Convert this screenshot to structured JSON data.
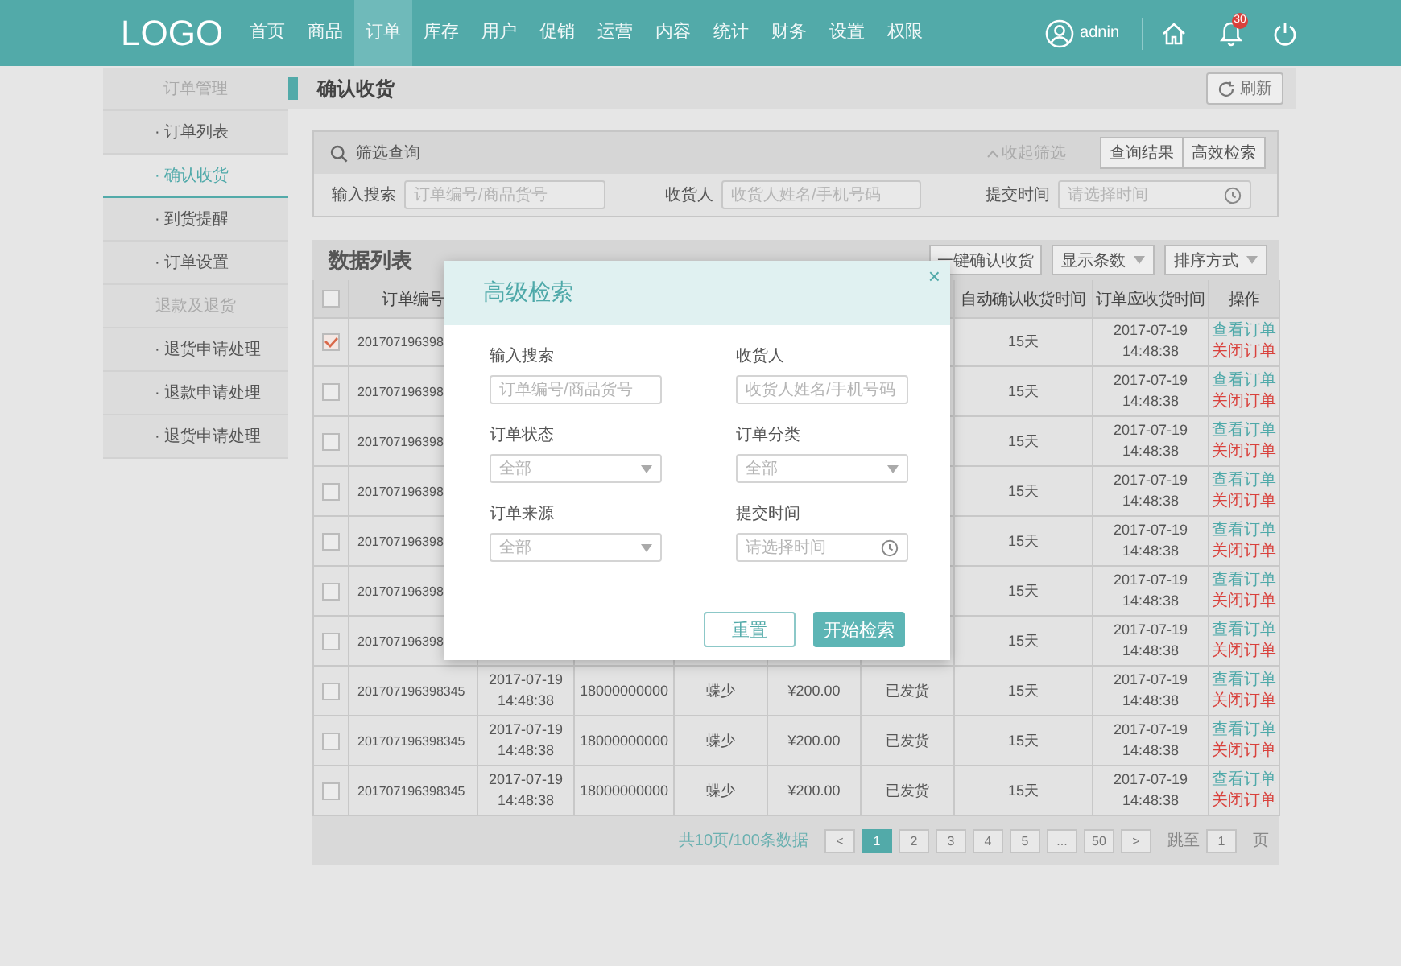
{
  "nav": {
    "logo": "LOGO",
    "items": [
      {
        "label": "首页",
        "selected": false
      },
      {
        "label": "商品",
        "selected": false
      },
      {
        "label": "订单",
        "selected": true
      },
      {
        "label": "库存",
        "selected": false
      },
      {
        "label": "用户",
        "selected": false
      },
      {
        "label": "促销",
        "selected": false
      },
      {
        "label": "运营",
        "selected": false
      },
      {
        "label": "内容",
        "selected": false
      },
      {
        "label": "统计",
        "selected": false
      },
      {
        "label": "财务",
        "selected": false
      },
      {
        "label": "设置",
        "selected": false
      },
      {
        "label": "权限",
        "selected": false
      }
    ],
    "user": "adnin",
    "notification_count": "30"
  },
  "sidebar": {
    "items": [
      {
        "kind": "heading",
        "label": "订单管理"
      },
      {
        "kind": "link",
        "label": "· 订单列表",
        "selected": false
      },
      {
        "kind": "link",
        "label": "· 确认收货",
        "selected": true
      },
      {
        "kind": "link",
        "label": "· 到货提醒",
        "selected": false
      },
      {
        "kind": "link",
        "label": "· 订单设置",
        "selected": false
      },
      {
        "kind": "heading",
        "label": "退款及退货"
      },
      {
        "kind": "link",
        "label": "· 退货申请处理",
        "selected": false
      },
      {
        "kind": "link",
        "label": "· 退款申请处理",
        "selected": false
      },
      {
        "kind": "link",
        "label": "· 退货申请处理",
        "selected": false
      }
    ]
  },
  "page_header": {
    "title": "确认收货",
    "refresh_button": "刷新"
  },
  "filter": {
    "title": "筛选查询",
    "collapse_link": "收起筛选",
    "buttons": [
      "查询结果",
      "高效检索"
    ],
    "fields": [
      {
        "kind": "text",
        "label": "输入搜索",
        "placeholder": "订单编号/商品货号"
      },
      {
        "kind": "text",
        "label": "收货人",
        "placeholder": "收货人姓名/手机号码"
      },
      {
        "kind": "time",
        "label": "提交时间",
        "placeholder": "请选择时间"
      }
    ]
  },
  "data_list": {
    "title": "数据列表",
    "confirm_all_button": "一键确认收货",
    "selects": [
      "显示条数",
      "排序方式"
    ],
    "table": {
      "header_checked": false,
      "columns": {
        "order_no": "订单编号",
        "auto_confirm": "自动确认收货时间",
        "due_time": "订单应收货时间",
        "actions": "操作"
      },
      "rows": [
        {
          "checked": true,
          "order_no": "201707196398",
          "auto_confirm": "15天",
          "due_time": "2017-07-19\n14:48:38",
          "actions": [
            {
              "kind": "view",
              "label": "查看订单"
            },
            {
              "kind": "close",
              "label": "关闭订单"
            }
          ]
        },
        {
          "checked": false,
          "order_no": "201707196398",
          "auto_confirm": "15天",
          "due_time": "2017-07-19\n14:48:38",
          "actions": [
            {
              "kind": "view",
              "label": "查看订单"
            },
            {
              "kind": "close",
              "label": "关闭订单"
            }
          ]
        },
        {
          "checked": false,
          "order_no": "201707196398",
          "auto_confirm": "15天",
          "due_time": "2017-07-19\n14:48:38",
          "actions": [
            {
              "kind": "view",
              "label": "查看订单"
            },
            {
              "kind": "close",
              "label": "关闭订单"
            }
          ]
        },
        {
          "checked": false,
          "order_no": "201707196398",
          "auto_confirm": "15天",
          "due_time": "2017-07-19\n14:48:38",
          "actions": [
            {
              "kind": "view",
              "label": "查看订单"
            },
            {
              "kind": "close",
              "label": "关闭订单"
            }
          ]
        },
        {
          "checked": false,
          "order_no": "201707196398",
          "auto_confirm": "15天",
          "due_time": "2017-07-19\n14:48:38",
          "actions": [
            {
              "kind": "view",
              "label": "查看订单"
            },
            {
              "kind": "close",
              "label": "关闭订单"
            }
          ]
        },
        {
          "checked": false,
          "order_no": "201707196398",
          "auto_confirm": "15天",
          "due_time": "2017-07-19\n14:48:38",
          "actions": [
            {
              "kind": "view",
              "label": "查看订单"
            },
            {
              "kind": "close",
              "label": "关闭订单"
            }
          ]
        },
        {
          "checked": false,
          "order_no": "201707196398",
          "auto_confirm": "15天",
          "due_time": "2017-07-19\n14:48:38",
          "actions": [
            {
              "kind": "view",
              "label": "查看订单"
            },
            {
              "kind": "close",
              "label": "关闭订单"
            }
          ]
        },
        {
          "checked": false,
          "order_no": "201707196398345",
          "submit_time": "2017-07-19\n14:48:38",
          "phone": "18000000000",
          "buyer": "蝶少",
          "amount": "¥200.00",
          "status": "已发货",
          "auto_confirm": "15天",
          "due_time": "2017-07-19\n14:48:38",
          "actions": [
            {
              "kind": "view",
              "label": "查看订单"
            },
            {
              "kind": "close",
              "label": "关闭订单"
            }
          ]
        },
        {
          "checked": false,
          "order_no": "201707196398345",
          "submit_time": "2017-07-19\n14:48:38",
          "phone": "18000000000",
          "buyer": "蝶少",
          "amount": "¥200.00",
          "status": "已发货",
          "auto_confirm": "15天",
          "due_time": "2017-07-19\n14:48:38",
          "actions": [
            {
              "kind": "view",
              "label": "查看订单"
            },
            {
              "kind": "close",
              "label": "关闭订单"
            }
          ]
        },
        {
          "checked": false,
          "order_no": "201707196398345",
          "submit_time": "2017-07-19\n14:48:38",
          "phone": "18000000000",
          "buyer": "蝶少",
          "amount": "¥200.00",
          "status": "已发货",
          "auto_confirm": "15天",
          "due_time": "2017-07-19\n14:48:38",
          "actions": [
            {
              "kind": "view",
              "label": "查看订单"
            },
            {
              "kind": "close",
              "label": "关闭订单"
            }
          ]
        }
      ]
    },
    "pagination": {
      "summary": "共10页/100条数据",
      "prev": "<",
      "pages": [
        {
          "label": "1",
          "selected": true
        },
        {
          "label": "2",
          "selected": false
        },
        {
          "label": "3",
          "selected": false
        },
        {
          "label": "4",
          "selected": false
        },
        {
          "label": "5",
          "selected": false
        },
        {
          "label": "...",
          "selected": false
        },
        {
          "label": "50",
          "selected": false
        }
      ],
      "next": ">",
      "jump_label": "跳至",
      "jump_value": "1",
      "jump_unit": "页"
    }
  },
  "modal": {
    "title": "高级检索",
    "close": "×",
    "fields": [
      {
        "kind": "text",
        "label": "输入搜索",
        "placeholder": "订单编号/商品货号"
      },
      {
        "kind": "text",
        "label": "收货人",
        "placeholder": "收货人姓名/手机号码"
      },
      {
        "kind": "select",
        "label": "订单状态",
        "value": "全部"
      },
      {
        "kind": "select",
        "label": "订单分类",
        "value": "全部"
      },
      {
        "kind": "select",
        "label": "订单来源",
        "value": "全部"
      },
      {
        "kind": "time",
        "label": "提交时间",
        "placeholder": "请选择时间"
      }
    ],
    "buttons": [
      {
        "kind": "secondary",
        "label": "重置"
      },
      {
        "kind": "primary",
        "label": "开始检索"
      }
    ]
  }
}
